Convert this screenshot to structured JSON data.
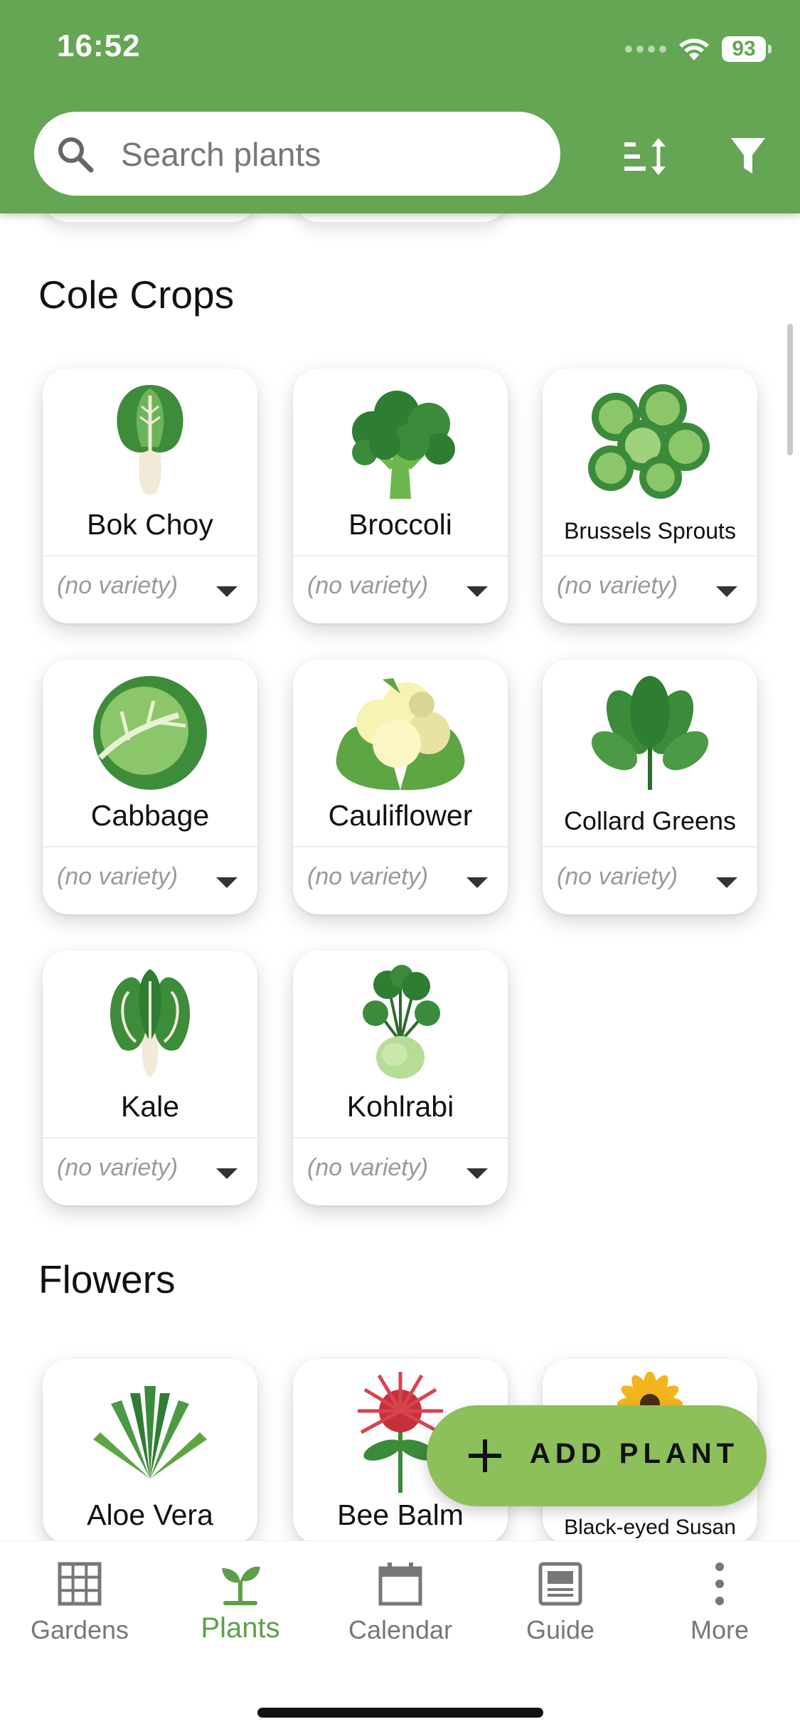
{
  "status": {
    "time": "16:52",
    "battery": "93"
  },
  "search": {
    "placeholder": "Search plants",
    "value": ""
  },
  "colors": {
    "header": "#64a653",
    "fab": "#8dbf5a",
    "active_tab": "#5d9f49"
  },
  "sections": [
    {
      "title": "Cole Crops",
      "plants": [
        {
          "name": "Bok Choy",
          "variety": "(no variety)",
          "icon": "bok-choy-icon"
        },
        {
          "name": "Broccoli",
          "variety": "(no variety)",
          "icon": "broccoli-icon"
        },
        {
          "name": "Brussels Sprouts",
          "variety": "(no variety)",
          "icon": "brussels-sprouts-icon"
        },
        {
          "name": "Cabbage",
          "variety": "(no variety)",
          "icon": "cabbage-icon"
        },
        {
          "name": "Cauliflower",
          "variety": "(no variety)",
          "icon": "cauliflower-icon"
        },
        {
          "name": "Collard Greens",
          "variety": "(no variety)",
          "icon": "collard-greens-icon"
        },
        {
          "name": "Kale",
          "variety": "(no variety)",
          "icon": "kale-icon"
        },
        {
          "name": "Kohlrabi",
          "variety": "(no variety)",
          "icon": "kohlrabi-icon"
        }
      ]
    },
    {
      "title": "Flowers",
      "plants": [
        {
          "name": "Aloe Vera",
          "icon": "aloe-vera-icon"
        },
        {
          "name": "Bee Balm",
          "icon": "bee-balm-icon"
        },
        {
          "name": "Black-eyed Susan",
          "icon": "black-eyed-susan-icon"
        }
      ]
    }
  ],
  "fab": {
    "label": "ADD PLANT"
  },
  "tabs": [
    {
      "label": "Gardens",
      "icon": "grid-icon",
      "active": false
    },
    {
      "label": "Plants",
      "icon": "sprout-icon",
      "active": true
    },
    {
      "label": "Calendar",
      "icon": "calendar-icon",
      "active": false
    },
    {
      "label": "Guide",
      "icon": "guide-icon",
      "active": false
    },
    {
      "label": "More",
      "icon": "more-icon",
      "active": false
    }
  ]
}
